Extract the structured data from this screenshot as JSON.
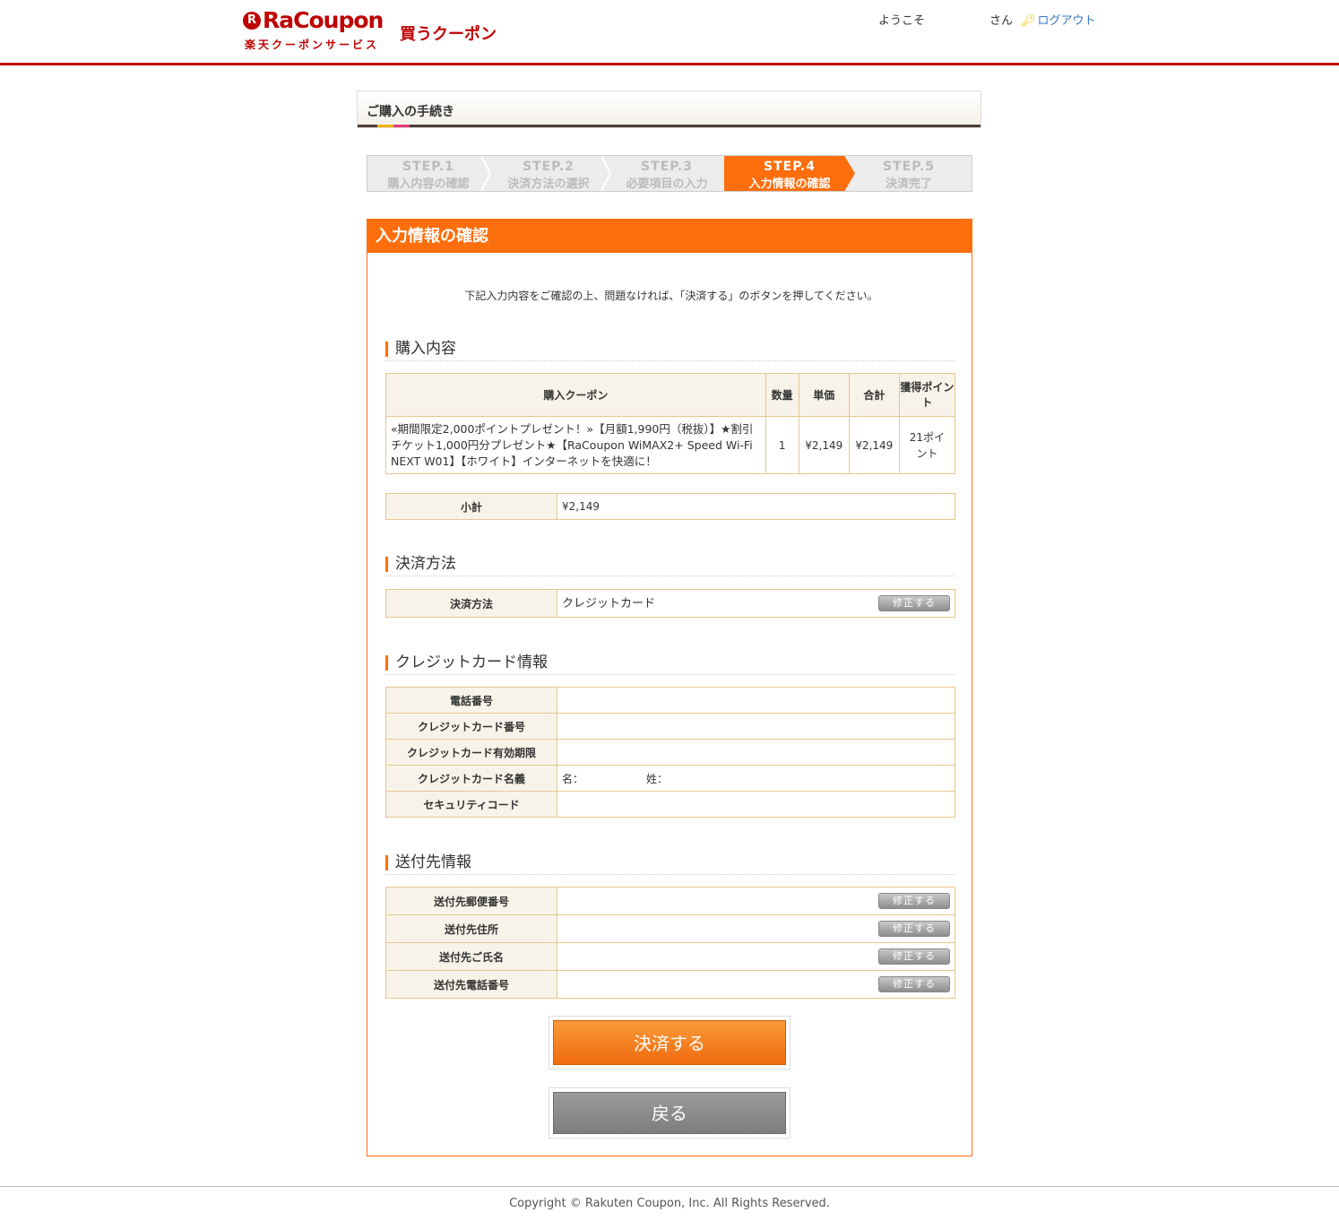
{
  "header": {
    "logo_text": "RaCoupon",
    "logo_mark": "R",
    "logo_sub": "楽天クーポンサービス",
    "logo_kau": "買うクーポン",
    "welcome": "ようこそ",
    "san": "さん",
    "logout": "ログアウト",
    "key_icon": "key-icon"
  },
  "procedure": {
    "title": "ご購入の手続き"
  },
  "steps": [
    {
      "label": "STEP.1",
      "sub": "購入内容の確認"
    },
    {
      "label": "STEP.2",
      "sub": "決済方法の選択"
    },
    {
      "label": "STEP.3",
      "sub": "必要項目の入力"
    },
    {
      "label": "STEP.4",
      "sub": "入力情報の確認"
    },
    {
      "label": "STEP.5",
      "sub": "決済完了"
    }
  ],
  "active_step": 4,
  "main": {
    "heading": "入力情報の確認",
    "intro": "下記入力内容をご確認の上、問題なければ、「決済する」のボタンを押してください。",
    "purchase": {
      "title": "購入内容",
      "headers": {
        "coupon": "購入クーポン",
        "qty": "数量",
        "unit": "単価",
        "total": "合計",
        "points": "獲得ポイント"
      },
      "item": {
        "name": "«期間限定2,000ポイントプレゼント！»【月額1,990円（税抜）】★割引チケット1,000円分プレゼント★【RaCoupon WiMAX2+ Speed Wi-Fi NEXT W01】【ホワイト】インターネットを快適に！",
        "qty": "1",
        "unit": "¥2,149",
        "total": "¥2,149",
        "points": "21ポイント"
      },
      "subtotal_label": "小計",
      "subtotal_value": "¥2,149"
    },
    "payment": {
      "title": "決済方法",
      "label": "決済方法",
      "value": "クレジットカード",
      "edit": "修正する"
    },
    "card": {
      "title": "クレジットカード情報",
      "rows": [
        {
          "label": "電話番号",
          "value": ""
        },
        {
          "label": "クレジットカード番号",
          "value": ""
        },
        {
          "label": "クレジットカード有効期限",
          "value": ""
        },
        {
          "label": "クレジットカード名義",
          "value": ""
        },
        {
          "label": "セキュリティコード",
          "value": ""
        }
      ],
      "name_first": "名：",
      "name_last": "姓："
    },
    "shipping": {
      "title": "送付先情報",
      "rows": [
        {
          "label": "送付先郵便番号",
          "value": ""
        },
        {
          "label": "送付先住所",
          "value": ""
        },
        {
          "label": "送付先ご氏名",
          "value": ""
        },
        {
          "label": "送付先電話番号",
          "value": ""
        }
      ],
      "edit": "修正する"
    },
    "pay_button": "決済する",
    "back_button": "戻る"
  },
  "footer": {
    "copyright": "Copyright © Rakuten Coupon, Inc. All Rights Reserved."
  },
  "colors": {
    "brand": "#bf0000",
    "accent": "#ff6e0c",
    "link": "#3a77c2"
  }
}
